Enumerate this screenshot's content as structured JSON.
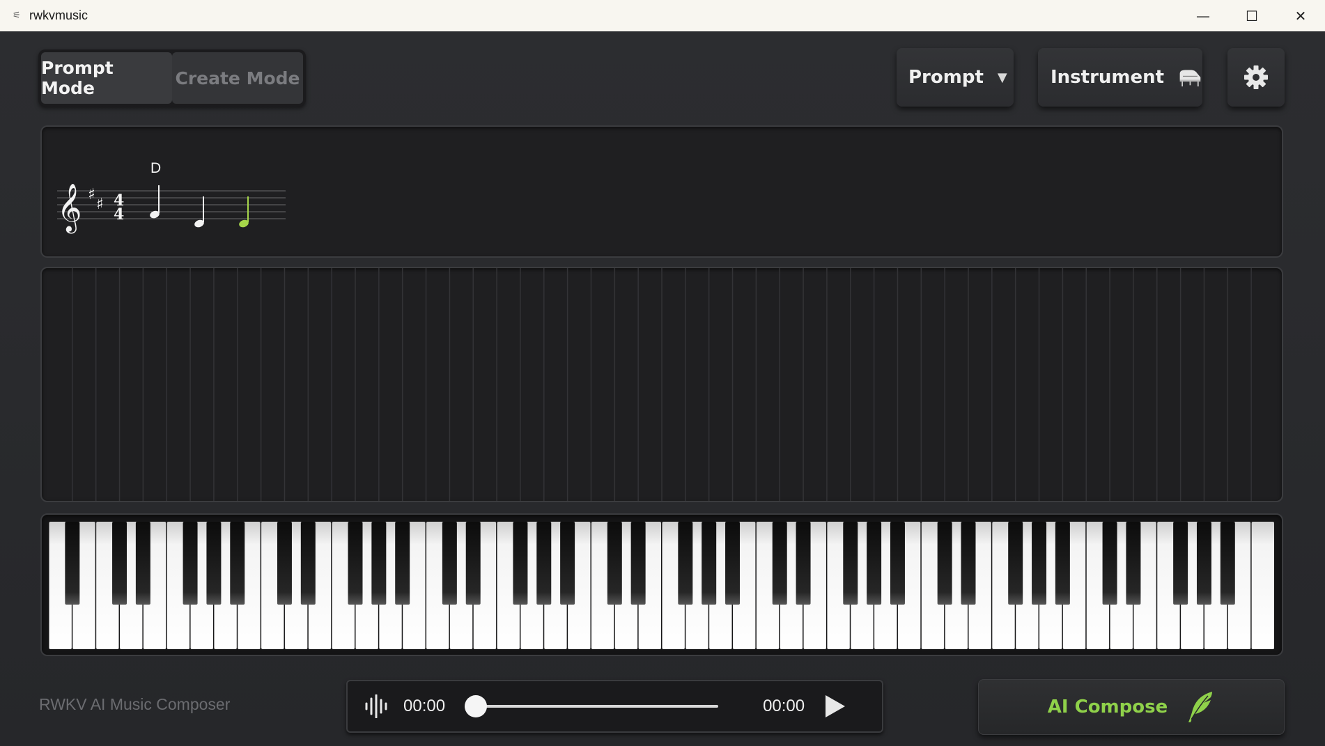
{
  "window": {
    "title": "rwkvmusic",
    "minimize": "—",
    "maximize": "☐",
    "close": "✕"
  },
  "toolbar": {
    "prompt_mode": "Prompt Mode",
    "create_mode": "Create Mode",
    "active_mode": "Prompt Mode",
    "prompt_label": "Prompt",
    "instrument_label": "Instrument"
  },
  "score": {
    "chord_label": "D",
    "key_signature": "D major (2 sharps)",
    "time_signature_top": "4",
    "time_signature_bottom": "4",
    "highlight_color": "#a6d64a"
  },
  "footer": {
    "app_label": "RWKV AI Music Composer",
    "current_time": "00:00",
    "total_time": "00:00",
    "progress": 0,
    "compose_label": "AI Compose",
    "accent_color": "#8fd14a"
  },
  "icons": {
    "app": "app-icon",
    "dropdown": "caret-down-icon",
    "instrument": "piano-icon",
    "settings": "gear-icon",
    "waveform": "waveform-icon",
    "play": "play-icon",
    "compose": "feather-icon"
  }
}
